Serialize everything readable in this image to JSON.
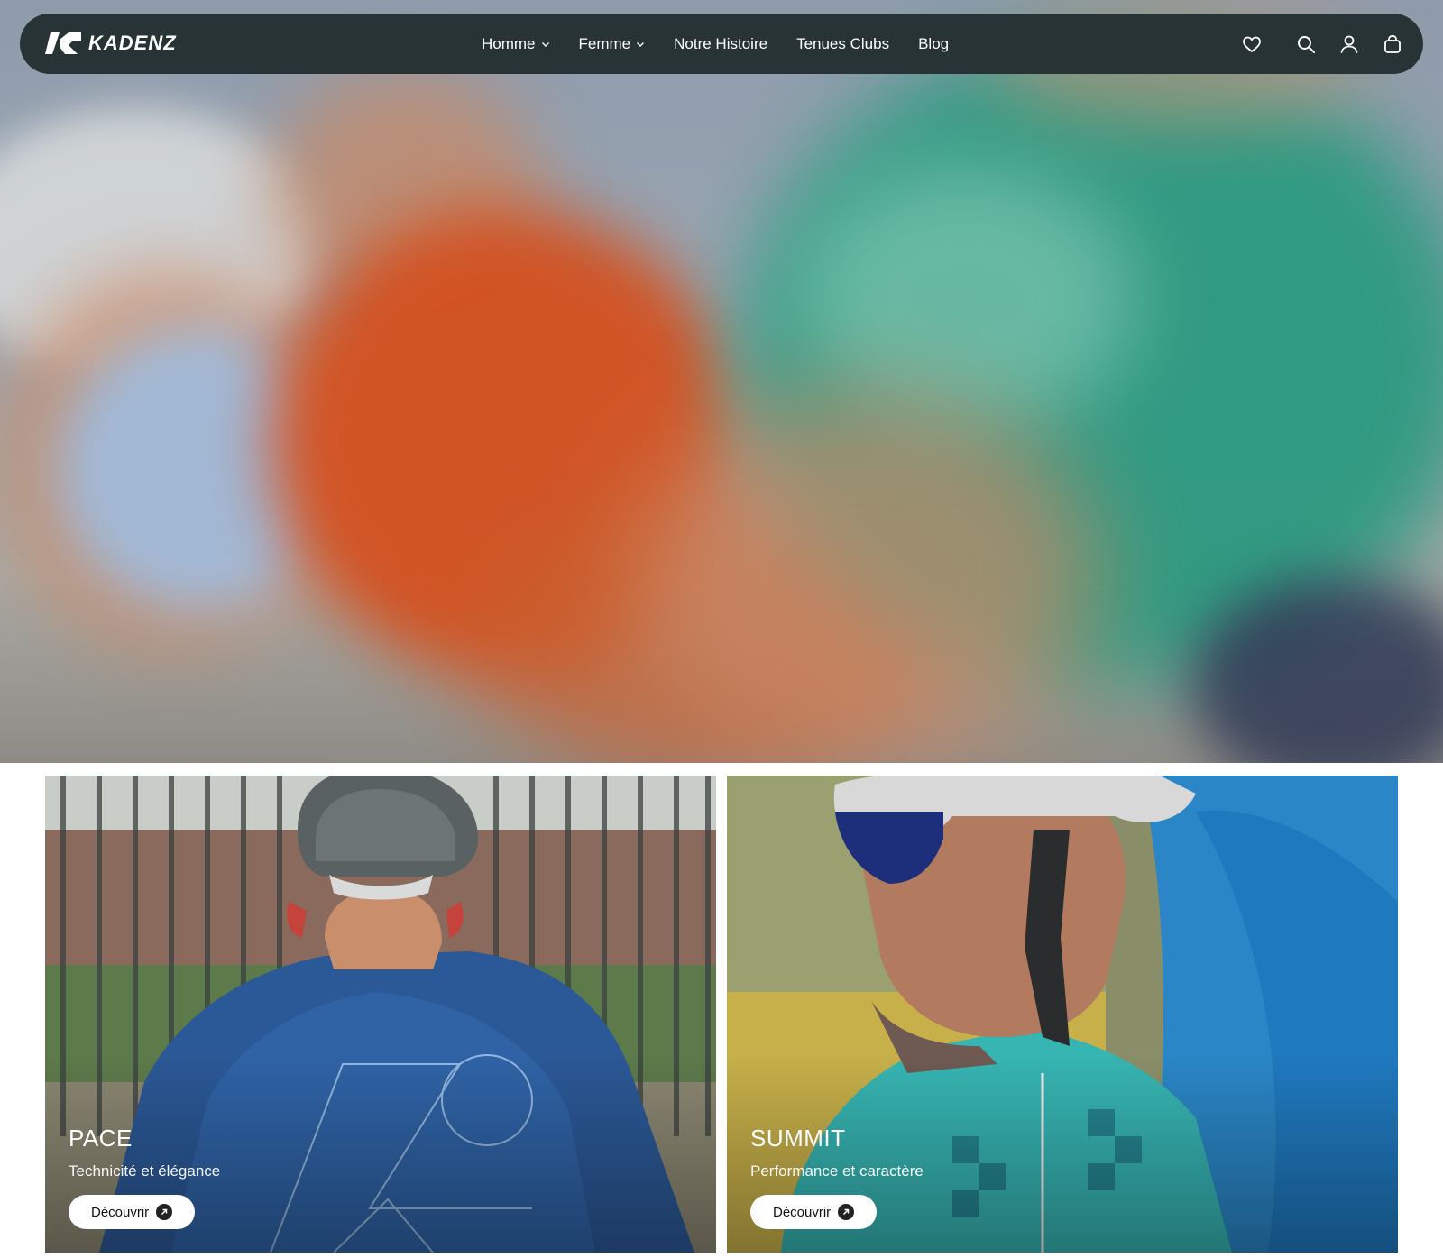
{
  "brand": {
    "name": "KADENZ"
  },
  "nav": {
    "items": [
      {
        "label": "Homme",
        "has_dropdown": true
      },
      {
        "label": "Femme",
        "has_dropdown": true
      },
      {
        "label": "Notre Histoire",
        "has_dropdown": false
      },
      {
        "label": "Tenues Clubs",
        "has_dropdown": false
      },
      {
        "label": "Blog",
        "has_dropdown": false
      }
    ],
    "icons": [
      "heart-icon",
      "search-icon",
      "account-icon",
      "cart-icon"
    ]
  },
  "cards": [
    {
      "title": "PACE",
      "subtitle": "Technicité et élégance",
      "button": "Découvrir"
    },
    {
      "title": "SUMMIT",
      "subtitle": "Performance et caractère",
      "button": "Découvrir"
    }
  ],
  "colors": {
    "nav_bg": "#283335",
    "text_light": "#ffffff",
    "button_bg": "#ffffff",
    "button_icon_bg": "#222222"
  }
}
